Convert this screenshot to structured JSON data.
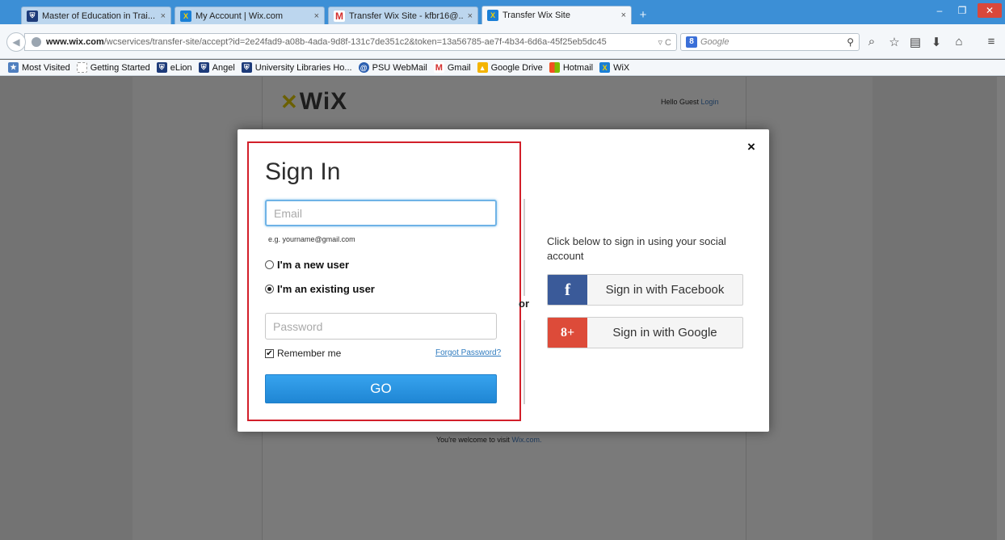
{
  "browser": {
    "tabs": [
      {
        "title": "Master of Education in Trai...",
        "icon": "shield-icon"
      },
      {
        "title": "My Account | Wix.com",
        "icon": "wix-icon"
      },
      {
        "title": "Transfer Wix Site - kfbr16@...",
        "icon": "gmail-icon"
      },
      {
        "title": "Transfer Wix Site",
        "icon": "wix-icon"
      }
    ],
    "active_tab": 3,
    "new_tab_label": "+",
    "url_domain": "www.wix.com",
    "url_path": "/wcservices/transfer-site/accept?id=2e24fad9-a08b-4ada-9d8f-131c7de351c2&token=13a56785-ae7f-4b34-6d6a-45f25eb5dc45",
    "search_placeholder": "Google",
    "bookmarks": [
      {
        "label": "Most Visited",
        "icon": "most-visited-icon",
        "color": "#4f7fbf"
      },
      {
        "label": "Getting Started",
        "icon": "getting-started-icon",
        "color": "#cccccc"
      },
      {
        "label": "eLion",
        "icon": "shield-icon",
        "color": "#1d3b7a"
      },
      {
        "label": "Angel",
        "icon": "shield-icon",
        "color": "#1d3b7a"
      },
      {
        "label": "University Libraries Ho...",
        "icon": "shield-icon",
        "color": "#1d3b7a"
      },
      {
        "label": "PSU WebMail",
        "icon": "webmail-icon",
        "color": "#2b5fb0"
      },
      {
        "label": "Gmail",
        "icon": "gmail-icon",
        "color": "#d32f2f"
      },
      {
        "label": "Google Drive",
        "icon": "google-drive-icon",
        "color": "#f4b400"
      },
      {
        "label": "Hotmail",
        "icon": "hotmail-icon",
        "color": "#f25022"
      },
      {
        "label": "WiX",
        "icon": "wix-icon",
        "color": "#1a7fd6"
      }
    ]
  },
  "page": {
    "logo_text": "WiX",
    "hello_text": "Hello Guest",
    "login_link": "Login",
    "welcome_text": "You're welcome to visit",
    "welcome_link": "Wix.com."
  },
  "signin": {
    "title": "Sign In",
    "email_placeholder": "Email",
    "email_hint": "e.g. yourname@gmail.com",
    "new_user_label": "I'm a new user",
    "existing_user_label": "I'm an existing user",
    "selected_option": "existing",
    "password_placeholder": "Password",
    "remember_label": "Remember me",
    "remember_checked": true,
    "forgot_label": "Forgot Password?",
    "go_label": "GO",
    "or_label": "or",
    "close_label": "×"
  },
  "social": {
    "caption": "Click below to sign in using your social account",
    "facebook_label": "Sign in with Facebook",
    "google_label": "Sign in with Google",
    "facebook_color": "#3a5a99",
    "google_color": "#dd4b39"
  },
  "colors": {
    "accent": "#2a93e0",
    "highlight_border": "#d21f2a",
    "link": "#2f7bbf"
  }
}
